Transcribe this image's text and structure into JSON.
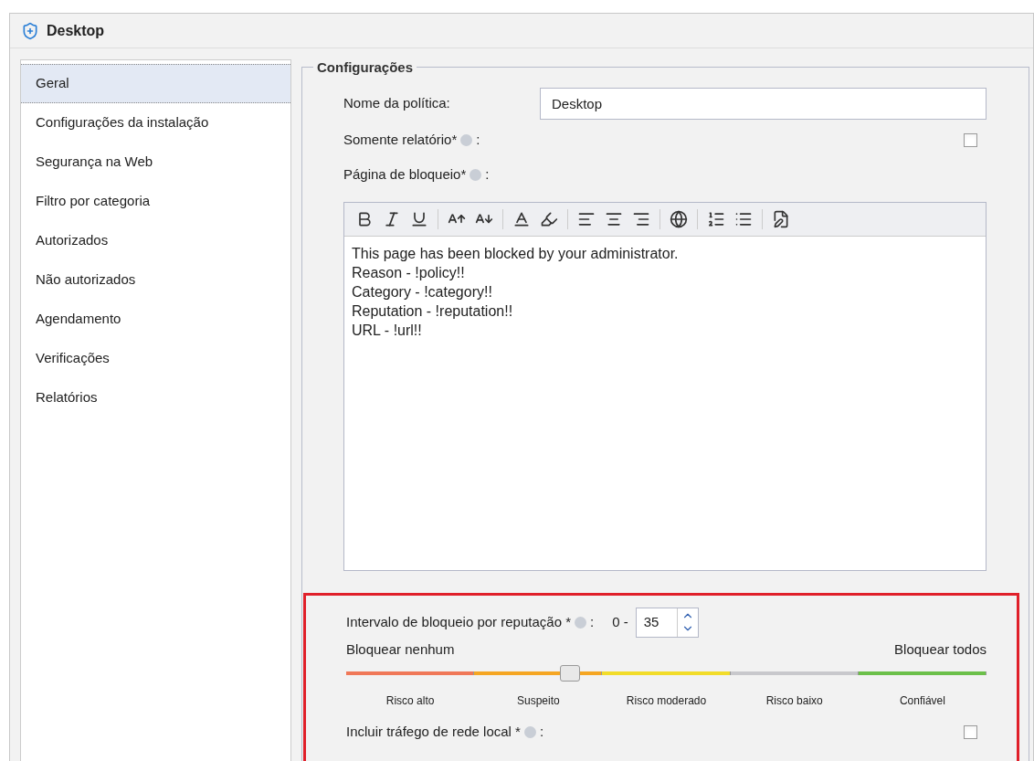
{
  "window": {
    "title": "Desktop"
  },
  "sidebar": {
    "items": [
      {
        "label": "Geral",
        "selected": true
      },
      {
        "label": "Configurações da instalação",
        "selected": false
      },
      {
        "label": "Segurança na Web",
        "selected": false
      },
      {
        "label": "Filtro por categoria",
        "selected": false
      },
      {
        "label": "Autorizados",
        "selected": false
      },
      {
        "label": "Não autorizados",
        "selected": false
      },
      {
        "label": "Agendamento",
        "selected": false
      },
      {
        "label": "Verificações",
        "selected": false
      },
      {
        "label": "Relatórios",
        "selected": false
      }
    ]
  },
  "settings": {
    "legend": "Configurações",
    "policy_name": {
      "label": "Nome da política:",
      "value": "Desktop"
    },
    "report_only": {
      "label": "Somente relatório*",
      "suffix": ":",
      "checked": false
    },
    "block_page": {
      "label": "Página de bloqueio*",
      "suffix": ":",
      "lines": [
        "This page has been blocked by your administrator.",
        "Reason - !policy!!",
        "Category - !category!!",
        "Reputation - !reputation!!",
        "URL - !url!!"
      ]
    },
    "reputation": {
      "label": "Intervalo de bloqueio por reputação *",
      "suffix": ":",
      "range_start": "0 -",
      "value": "35",
      "left_label": "Bloquear nenhum",
      "right_label": "Bloquear todos",
      "level": 0.35,
      "segments": [
        {
          "label": "Risco alto",
          "color": "#f07858"
        },
        {
          "label": "Suspeito",
          "color": "#f5a623"
        },
        {
          "label": "Risco moderado",
          "color": "#f2dc2a"
        },
        {
          "label": "Risco baixo",
          "color": "#c8c8cc"
        },
        {
          "label": "Confiável",
          "color": "#6cc04a"
        }
      ]
    },
    "local_traffic": {
      "label": "Incluir tráfego de rede local *",
      "suffix": ":",
      "checked": false
    }
  }
}
